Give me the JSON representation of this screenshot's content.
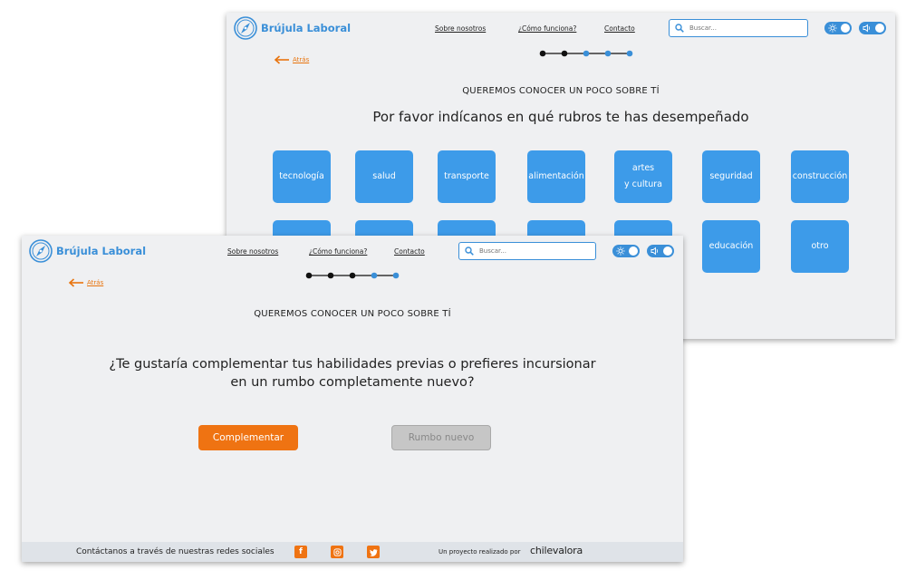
{
  "brand": {
    "name": "Brújula Laboral"
  },
  "nav": {
    "about": "Sobre nosotros",
    "how": "¿Cómo funciona?",
    "contact": "Contacto"
  },
  "search": {
    "placeholder": "Buscar..."
  },
  "back_label": "Atrás",
  "eyebrow": "QUEREMOS CONOCER UN POCO SOBRE TÍ",
  "colors": {
    "accent": "#3a8fd8",
    "tile": "#3d9be9",
    "primary": "#ef7312",
    "step_done": "#111111",
    "step_todo": "#3a8fd8"
  },
  "back_screen": {
    "question": "Por favor indícanos en qué rubros te has desempeñado",
    "progress": {
      "steps": 5,
      "completed": 2
    },
    "tiles_row1": [
      "tecnología",
      "salud",
      "transporte",
      "alimentación",
      "artes\ny cultura",
      "seguridad",
      "construcción"
    ],
    "tiles_row2": [
      "",
      "",
      "",
      "",
      "",
      "educación",
      "otro"
    ]
  },
  "front_screen": {
    "question_line1": "¿Te gustaría complementar tus habilidades previas o prefieres incursionar",
    "question_line2": "en un rumbo completamente nuevo?",
    "progress": {
      "steps": 5,
      "completed": 3
    },
    "button_primary": "Complementar",
    "button_secondary": "Rumbo nuevo"
  },
  "footer": {
    "contact_text": "Contáctanos a través de nuestras redes sociales",
    "social": [
      "facebook-icon",
      "instagram-icon",
      "twitter-icon"
    ],
    "credit": "Un proyecto realizado por",
    "partner": "chilevalora"
  }
}
